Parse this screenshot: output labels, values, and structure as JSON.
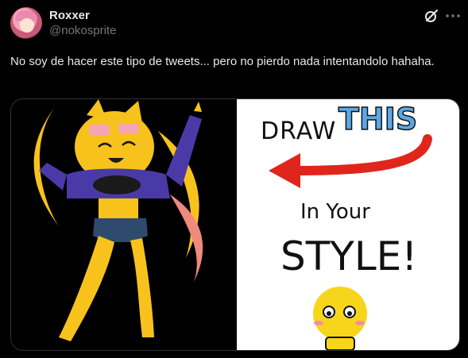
{
  "tweet": {
    "author_name": "Roxxer",
    "author_handle": "@nokosprite",
    "text": "No soy de hacer este tipo de tweets... pero no pierdo nada intentandolo hahaha."
  },
  "icons": {
    "grok": "grok-icon",
    "more": "more-options-icon"
  },
  "media": {
    "right_panel": {
      "line1_a": "DRAW",
      "line1_b": "THIS",
      "line2": "In Your",
      "line3": "STYLE!"
    }
  },
  "colors": {
    "background": "#000000",
    "text_primary": "#e7e9ea",
    "text_secondary": "#71767b",
    "arrow_red": "#e0261c",
    "this_blue": "#5aa9e6"
  }
}
